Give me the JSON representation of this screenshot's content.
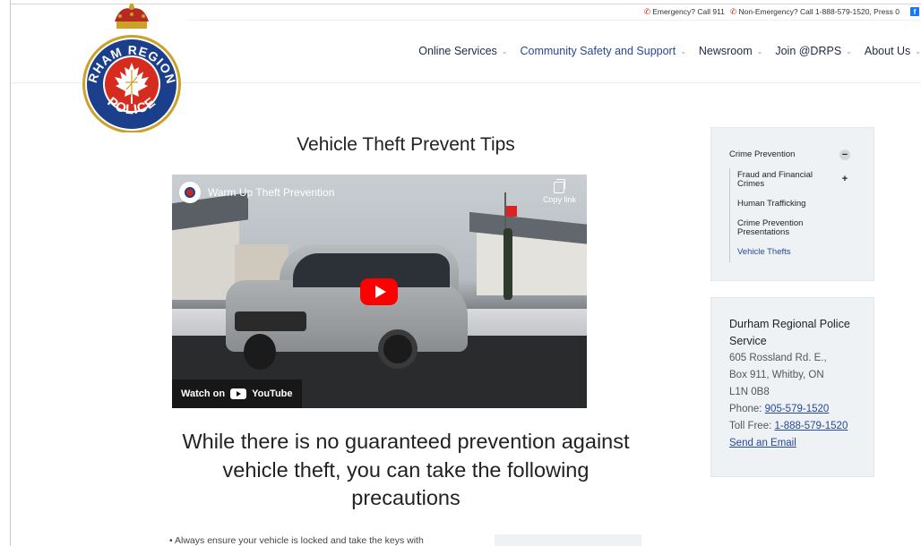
{
  "utility_bar": {
    "emergency": "Emergency? Call 911",
    "non_emergency": "Non-Emergency? Call 1-888-579-1520, Press 0",
    "social_icon": "facebook-icon"
  },
  "logo": {
    "text_top": "DURHAM REGIONAL",
    "text_bottom": "POLICE",
    "colors": {
      "navy": "#1b3f8a",
      "red": "#d62c1f",
      "gold": "#c9a227"
    }
  },
  "nav": {
    "items": [
      {
        "label": "Online Services",
        "active": false
      },
      {
        "label": "Community Safety and Support",
        "active": true
      },
      {
        "label": "Newsroom",
        "active": false
      },
      {
        "label": "Join @DRPS",
        "active": false
      },
      {
        "label": "About Us",
        "active": false
      }
    ],
    "chevron": "chevron-down-icon"
  },
  "page": {
    "title": "Vehicle Theft Prevent Tips",
    "video": {
      "title": "Warm Up Theft Prevention",
      "copy_link": "Copy link",
      "watch_on": "Watch on",
      "brand": "YouTube"
    },
    "subheading": "While there is no guaranteed prevention against vehicle theft, you can take the following precautions",
    "first_bullet": "• Always ensure your vehicle is locked and take the keys with"
  },
  "sidebar": {
    "items": [
      {
        "label": "Crime Prevention",
        "toggle": "−"
      },
      {
        "label": "Fraud and Financial Crimes",
        "toggle": "+"
      },
      {
        "label": "Human Trafficking"
      },
      {
        "label": "Crime Prevention Presentations"
      },
      {
        "label": "Vehicle Thefts",
        "current": true
      }
    ]
  },
  "contact": {
    "name": "Durham Regional Police Service",
    "address1": "605 Rossland Rd. E.,",
    "address2": "Box 911, Whitby, ON",
    "postal": "L1N 0B8",
    "phone_label": "Phone:",
    "phone": "905-579-1520",
    "tollfree_label": "Toll Free:",
    "tollfree": "1-888-579-1520",
    "email_link": "Send an Email"
  },
  "accent_color": "#27479a"
}
